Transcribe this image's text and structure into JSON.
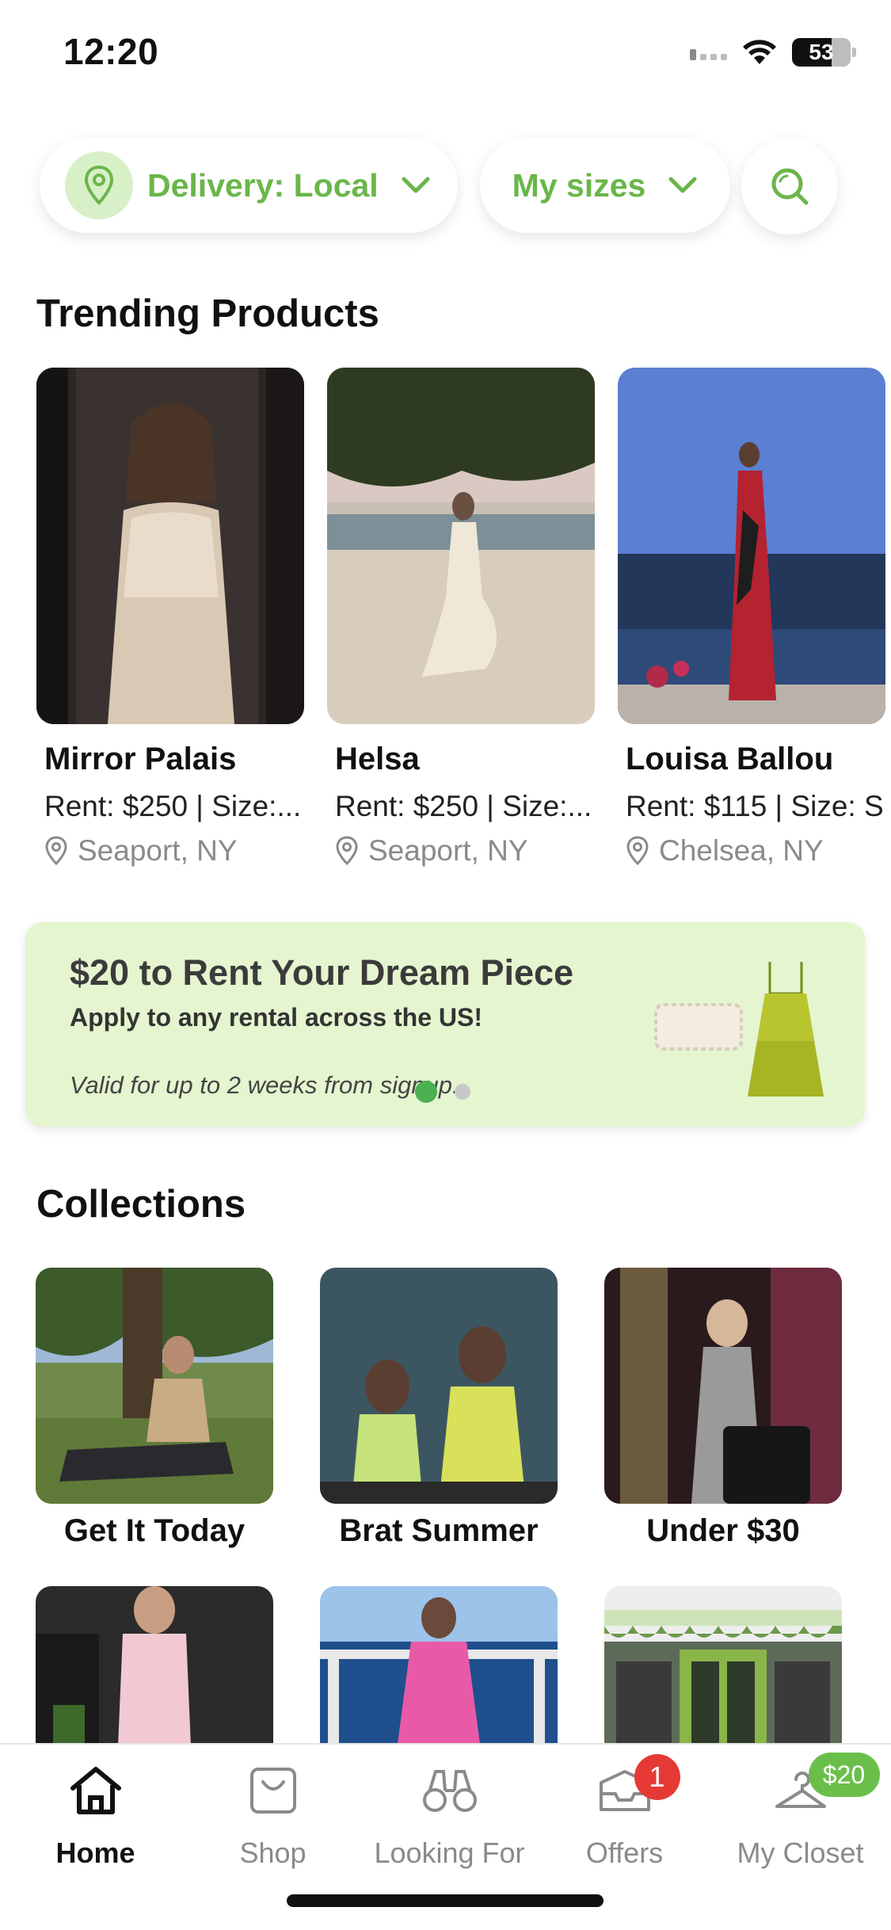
{
  "status_bar": {
    "time": "12:20",
    "battery": "53"
  },
  "filters": {
    "delivery_label": "Delivery: Local",
    "sizes_label": "My sizes"
  },
  "trending": {
    "title": "Trending Products",
    "products": [
      {
        "name": "Mirror Palais",
        "meta": "Rent: $250 | Size:...",
        "location": "Seaport, NY"
      },
      {
        "name": "Helsa",
        "meta": "Rent: $250 | Size:...",
        "location": "Seaport, NY"
      },
      {
        "name": "Louisa Ballou",
        "meta": "Rent: $115 | Size: S",
        "location": "Chelsea, NY"
      }
    ]
  },
  "promo": {
    "title": "$20 to Rent Your Dream Piece",
    "subtitle": "Apply to any rental across the US!",
    "valid": "Valid for up to 2 weeks from signup."
  },
  "collections": {
    "title": "Collections",
    "items": [
      {
        "label": "Get It Today"
      },
      {
        "label": "Brat Summer"
      },
      {
        "label": "Under $30"
      },
      {
        "label": ""
      },
      {
        "label": ""
      },
      {
        "label": ""
      }
    ]
  },
  "nav": {
    "items": [
      {
        "label": "Home",
        "icon": "home-icon"
      },
      {
        "label": "Shop",
        "icon": "shopping-bag-icon"
      },
      {
        "label": "Looking For",
        "icon": "binoculars-icon"
      },
      {
        "label": "Offers",
        "icon": "inbox-icon",
        "badge": "1"
      },
      {
        "label": "My Closet",
        "icon": "hanger-icon",
        "badge": "$20"
      }
    ]
  },
  "colors": {
    "accent_green": "#6ab64a",
    "promo_bg": "#e4f5cf",
    "badge_red": "#e53935"
  }
}
